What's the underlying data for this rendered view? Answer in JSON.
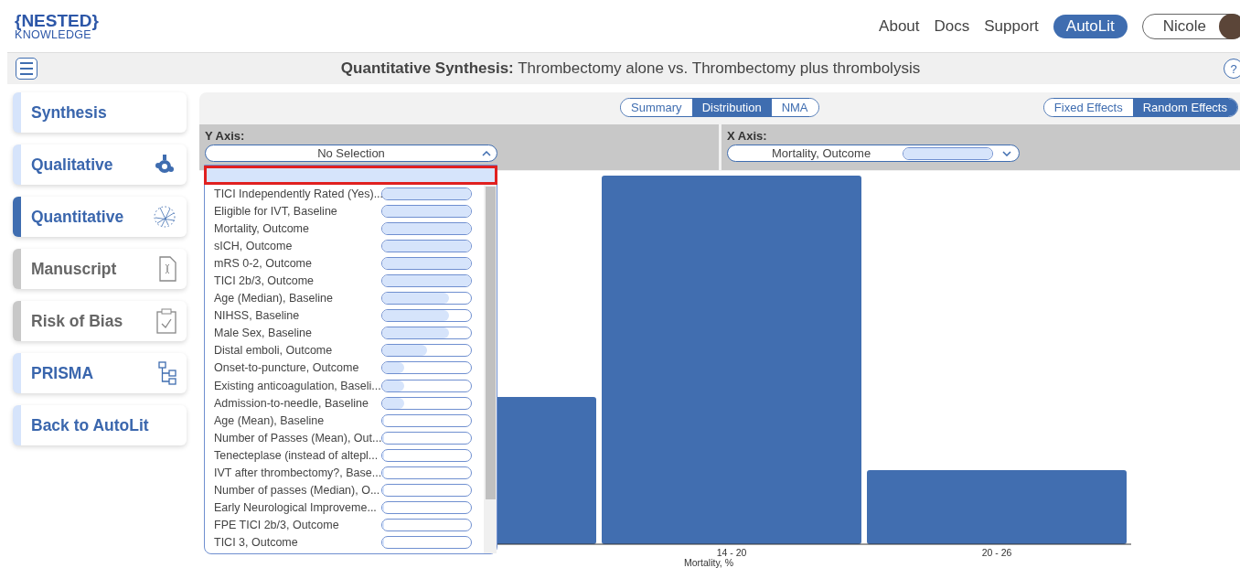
{
  "header": {
    "logo_top": "{NESTED}",
    "logo_bottom": "KNOWLEDGE",
    "nav": [
      "About",
      "Docs",
      "Support"
    ],
    "autolit_button": "AutoLit",
    "user_button": "Nicole"
  },
  "title_bar": {
    "title": "**Quantitative Synthesis:** Thrombectomy alone vs. Thrombectomy plus thrombolysis",
    "help": "?"
  },
  "sidebar": {
    "items": [
      {
        "label": "Synthesis",
        "selected": false,
        "disabled": false
      },
      {
        "label": "Qualitative",
        "selected": false,
        "disabled": false
      },
      {
        "label": "Quantitative",
        "selected": true,
        "disabled": false
      },
      {
        "label": "Manuscript",
        "selected": false,
        "disabled": true
      },
      {
        "label": "Risk of Bias",
        "selected": false,
        "disabled": true
      },
      {
        "label": "PRISMA",
        "selected": false,
        "disabled": false
      },
      {
        "label": "Back to AutoLit",
        "selected": false,
        "disabled": false
      }
    ]
  },
  "view_tabs": [
    {
      "label": "Summary",
      "selected": false
    },
    {
      "label": "Distribution",
      "selected": true
    },
    {
      "label": "NMA",
      "selected": false
    }
  ],
  "effect_tabs": [
    {
      "label": "Fixed Effects",
      "selected": false
    },
    {
      "label": "Random Effects",
      "selected": true
    }
  ],
  "y_axis": {
    "label": "Y Axis:",
    "value": "No Selection",
    "expanded": true,
    "options_first_row_highlighted": true,
    "options": [
      {
        "label": "TICI Independently Rated (Yes)...",
        "level": 1
      },
      {
        "label": "Eligible for IVT, Baseline",
        "level": 1
      },
      {
        "label": "Mortality, Outcome",
        "level": 1
      },
      {
        "label": "sICH, Outcome",
        "level": 1
      },
      {
        "label": "mRS 0-2, Outcome",
        "level": 1
      },
      {
        "label": "TICI 2b/3, Outcome",
        "level": 1
      },
      {
        "label": "Age (Median), Baseline",
        "level": 0.75
      },
      {
        "label": "NIHSS, Baseline",
        "level": 0.75
      },
      {
        "label": "Male Sex, Baseline",
        "level": 0.75
      },
      {
        "label": "Distal emboli, Outcome",
        "level": 0.5
      },
      {
        "label": "Onset-to-puncture, Outcome",
        "level": 0.25
      },
      {
        "label": "Existing anticoagulation, Baseli...",
        "level": 0.25
      },
      {
        "label": "Admission-to-needle, Baseline",
        "level": 0.25
      },
      {
        "label": "Age (Mean), Baseline",
        "level": 0
      },
      {
        "label": "Number of Passes (Mean), Out...",
        "level": 0
      },
      {
        "label": "Tenecteplase (instead of altepl...",
        "level": 0
      },
      {
        "label": "IVT after thrombectomy?, Base...",
        "level": 0
      },
      {
        "label": "Number of passes (Median), O...",
        "level": 0
      },
      {
        "label": "Early Neurological Improveme...",
        "level": 0
      },
      {
        "label": "FPE TICI 2b/3, Outcome",
        "level": 0
      },
      {
        "label": "TICI 3, Outcome",
        "level": 0
      }
    ]
  },
  "x_axis": {
    "label": "X Axis:",
    "value": "Mortality, Outcome",
    "level": 1,
    "expanded": false
  },
  "histogram": {
    "categories": [
      "14 - 20",
      "20 - 26"
    ],
    "xlabel": "Mortality, %"
  }
}
